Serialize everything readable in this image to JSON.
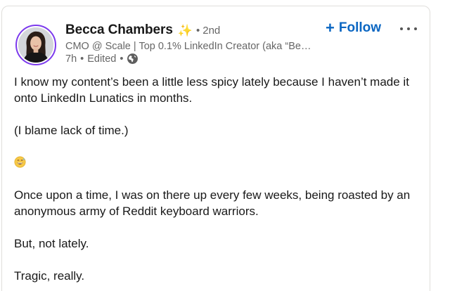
{
  "post": {
    "author": {
      "name": "Becca Chambers",
      "badge_icon": "sparkle-icon",
      "degree": "2nd",
      "headline": "CMO @ Scale | Top 0.1% LinkedIn Creator (aka “Be…",
      "time": "7h",
      "edited": "Edited",
      "visibility_icon": "globe-icon"
    },
    "follow_label": "Follow",
    "paragraphs": {
      "p1": "I know my content’s been a little less spicy lately because I haven’t made it onto LinkedIn Lunatics in months.",
      "p2": "(I blame lack of time.)",
      "p3_emoji": "grinning-sweat-emoji",
      "p4": "Once upon a time, I was on there up every few weeks, being roasted by an anonymous army of Reddit keyboard warriors.",
      "p5": "But, not lately.",
      "p6": "Tragic, really."
    }
  },
  "colors": {
    "follow_blue": "#0a66c2",
    "text": "#191919",
    "muted": "#666666",
    "avatar_ring": "#7c3aed",
    "sparkle": "#f5c24b"
  }
}
